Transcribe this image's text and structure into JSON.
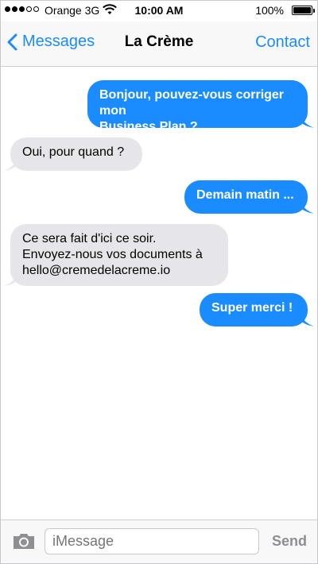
{
  "status_bar": {
    "carrier": "Orange 3G",
    "time": "10:00 AM",
    "battery": "100%",
    "signal_dots_filled": 3,
    "signal_dots_total": 5
  },
  "nav": {
    "back_label": "Messages",
    "title": "La Crème",
    "contact_label": "Contact"
  },
  "messages": [
    {
      "direction": "outgoing",
      "text": "Bonjour, pouvez-vous corriger mon\nBusiness Plan ?"
    },
    {
      "direction": "incoming",
      "text": "Oui, pour quand ?"
    },
    {
      "direction": "outgoing",
      "text": "Demain matin ..."
    },
    {
      "direction": "incoming",
      "text": "Ce sera fait d'ici ce soir.\nEnvoyez-nous vos documents à\nhello@cremedelacreme.io"
    },
    {
      "direction": "outgoing",
      "text": "Super merci !"
    }
  ],
  "composer": {
    "placeholder": "iMessage",
    "send_label": "Send"
  },
  "colors": {
    "accent": "#1a8cff",
    "incoming_bubble": "#e6e6ea",
    "outgoing_bubble": "#1a8cff"
  },
  "icons": [
    "chevron-left-icon",
    "camera-icon",
    "wifi-icon",
    "battery-icon"
  ]
}
